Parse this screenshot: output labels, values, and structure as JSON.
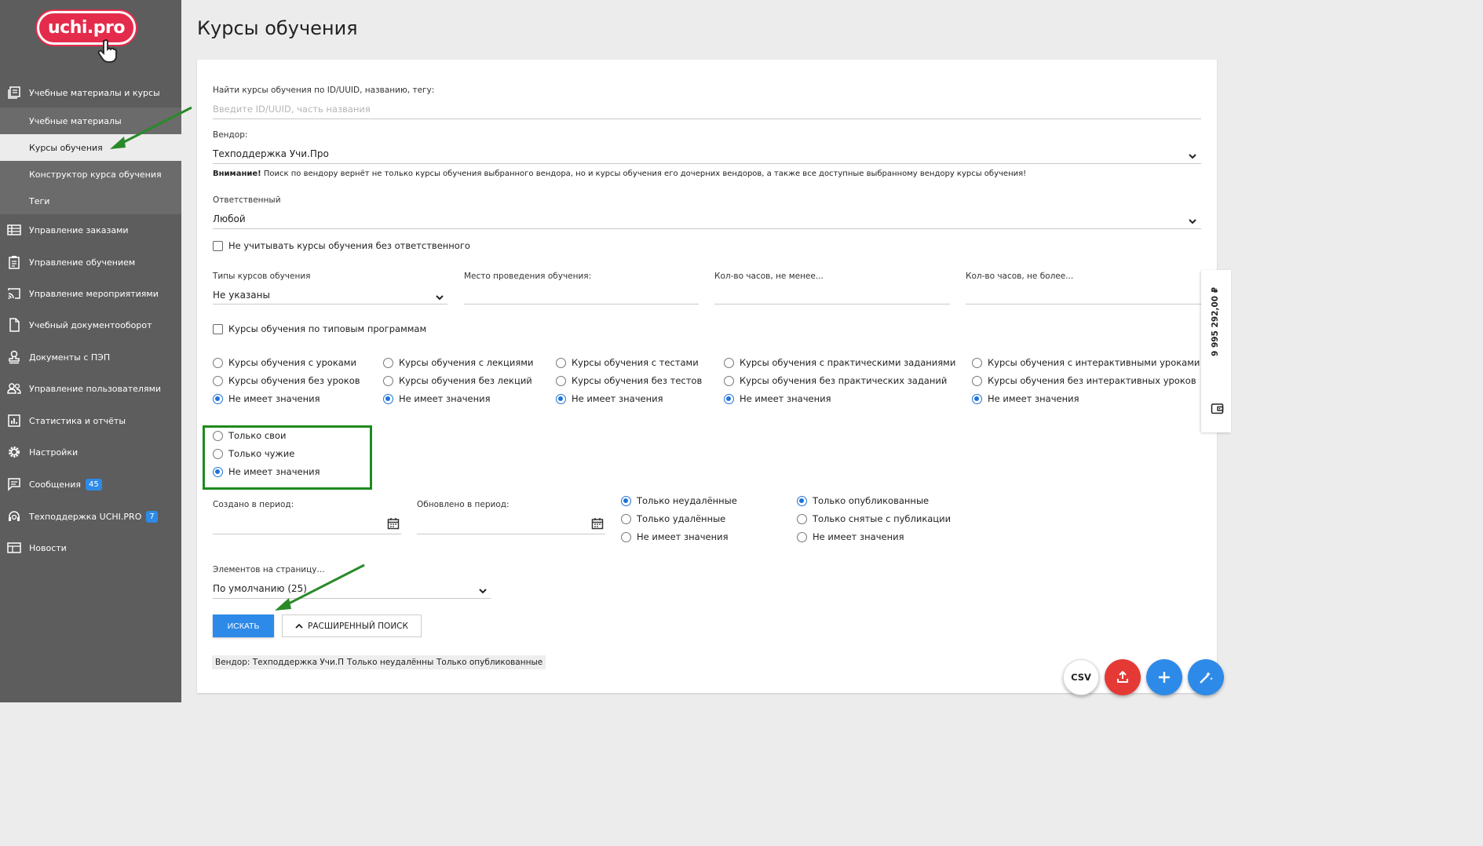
{
  "logo": {
    "text": "uchi.pro"
  },
  "sidebar": {
    "group": {
      "label": "Учебные материалы и курсы",
      "icon": "library-icon"
    },
    "sub_items": [
      {
        "label": "Учебные материалы"
      },
      {
        "label": "Курсы обучения",
        "active": true
      },
      {
        "label": "Конструктор курса обучения"
      },
      {
        "label": "Теги"
      }
    ],
    "items": [
      {
        "label": "Управление заказами",
        "icon": "list-icon"
      },
      {
        "label": "Управление обучением",
        "icon": "clipboard-icon"
      },
      {
        "label": "Управление мероприятиями",
        "icon": "cast-icon"
      },
      {
        "label": "Учебный документооборот",
        "icon": "document-icon"
      },
      {
        "label": "Документы с ПЭП",
        "icon": "stamp-icon"
      },
      {
        "label": "Управление пользователями",
        "icon": "users-icon"
      },
      {
        "label": "Статистика и отчёты",
        "icon": "chart-icon"
      },
      {
        "label": "Настройки",
        "icon": "gear-icon"
      },
      {
        "label": "Сообщения",
        "icon": "message-icon",
        "badge": "45"
      },
      {
        "label": "Техподдержка UCHI.PRO",
        "icon": "support-icon",
        "badge": "7"
      },
      {
        "label": "Новости",
        "icon": "news-icon"
      }
    ]
  },
  "page": {
    "title": "Курсы обучения"
  },
  "form": {
    "search": {
      "label": "Найти курсы обучения по ID/UUID, названию, тегу:",
      "placeholder": "Введите ID/UUID, часть названия",
      "value": ""
    },
    "vendor": {
      "label": "Вендор:",
      "value": "Техподдержка Учи.Про"
    },
    "notice": {
      "bold": "Внимание!",
      "text": " Поиск по вендору вернёт не только курсы обучения выбранного вендора, но и курсы обучения его дочерних вендоров, а также все доступные выбранному вендору курсы обучения!"
    },
    "responsible": {
      "label": "Ответственный",
      "value": "Любой"
    },
    "no_responsible_checkbox": {
      "label": "Не учитывать курсы обучения без ответственного",
      "checked": false
    },
    "course_types": {
      "label": "Типы курсов обучения",
      "value": "Не указаны"
    },
    "location": {
      "label": "Место проведения обучения:",
      "value": ""
    },
    "hours_min": {
      "label": "Кол-во часов, не менее...",
      "value": ""
    },
    "hours_max": {
      "label": "Кол-во часов, не более...",
      "value": ""
    },
    "typical_programs_checkbox": {
      "label": "Курсы обучения по типовым программам",
      "checked": false
    },
    "radio_groups": [
      {
        "options": [
          "Курсы обучения с уроками",
          "Курсы обучения без уроков",
          "Не имеет значения"
        ],
        "selected": 2
      },
      {
        "options": [
          "Курсы обучения с лекциями",
          "Курсы обучения без лекций",
          "Не имеет значения"
        ],
        "selected": 2
      },
      {
        "options": [
          "Курсы обучения с тестами",
          "Курсы обучения без тестов",
          "Не имеет значения"
        ],
        "selected": 2
      },
      {
        "options": [
          "Курсы обучения с практическими заданиями",
          "Курсы обучения без практических заданий",
          "Не имеет значения"
        ],
        "selected": 2
      },
      {
        "options": [
          "Курсы обучения с интерактивными уроками",
          "Курсы обучения без интерактивных уроков",
          "Не имеет значения"
        ],
        "selected": 2
      }
    ],
    "ownership": {
      "options": [
        "Только свои",
        "Только чужие",
        "Не имеет значения"
      ],
      "selected": 2
    },
    "created_period": {
      "label": "Создано в период:",
      "value": ""
    },
    "updated_period": {
      "label": "Обновлено в период:",
      "value": ""
    },
    "deleted_filter": {
      "options": [
        "Только неудалённые",
        "Только удалённые",
        "Не имеет значения"
      ],
      "selected": 0
    },
    "published_filter": {
      "options": [
        "Только опубликованные",
        "Только снятые с публикации",
        "Не имеет значения"
      ],
      "selected": 0
    },
    "per_page": {
      "label": "Элементов на страницу...",
      "value": "По умолчанию (25)"
    },
    "search_button": "ИСКАТЬ",
    "advanced_button": "РАСШИРЕННЫЙ ПОИСК",
    "chips": [
      "Вендор: Техподдержка Учи.Про",
      "Только неудалённые",
      "Только опубликованные"
    ]
  },
  "side_tab": {
    "balance": "9 995 292,00 ₽",
    "icon": "wallet-icon"
  },
  "fabs": {
    "csv": "CSV",
    "upload_icon": "upload-icon",
    "add_icon": "plus-icon",
    "magic_icon": "magic-wand-icon"
  },
  "colors": {
    "accent": "#2d8ae8",
    "sidebar": "#5d5d5d",
    "danger": "#e53935",
    "highlight": "#1e8a1e",
    "logo": "#e52b4b"
  }
}
